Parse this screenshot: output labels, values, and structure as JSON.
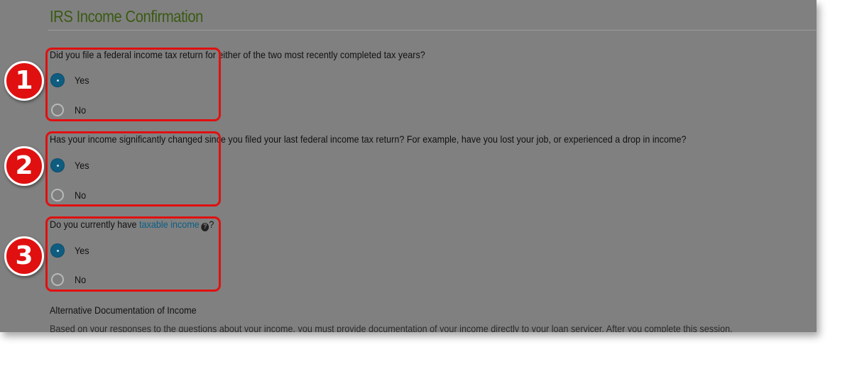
{
  "page": {
    "title": "IRS Income Confirmation"
  },
  "questions": [
    {
      "text": "Did you file a federal income tax return for either of the two most recently completed tax years?",
      "options": [
        {
          "label": "Yes",
          "selected": true
        },
        {
          "label": "No",
          "selected": false
        }
      ]
    },
    {
      "text": "Has your income significantly changed since you filed your last federal income tax return? For example, have you lost your job, or experienced a drop in income?",
      "options": [
        {
          "label": "Yes",
          "selected": true
        },
        {
          "label": "No",
          "selected": false
        }
      ]
    },
    {
      "text_prefix": "Do you currently have ",
      "link_text": "taxable income",
      "help_icon": "?",
      "text_suffix": "?",
      "options": [
        {
          "label": "Yes",
          "selected": true
        },
        {
          "label": "No",
          "selected": false
        }
      ]
    }
  ],
  "section": {
    "heading": "Alternative Documentation of Income",
    "body": "Based on your responses to the questions about your income, you must provide documentation of your income directly to your loan servicer. After you complete this session,"
  },
  "annotations": {
    "badges": [
      "1",
      "2",
      "3"
    ],
    "highlight_color": "#e01010"
  },
  "colors": {
    "title": "#3a5a12",
    "link": "#0a5f86",
    "radio_checked": "#0e5c7f",
    "overlay": "#808080"
  }
}
